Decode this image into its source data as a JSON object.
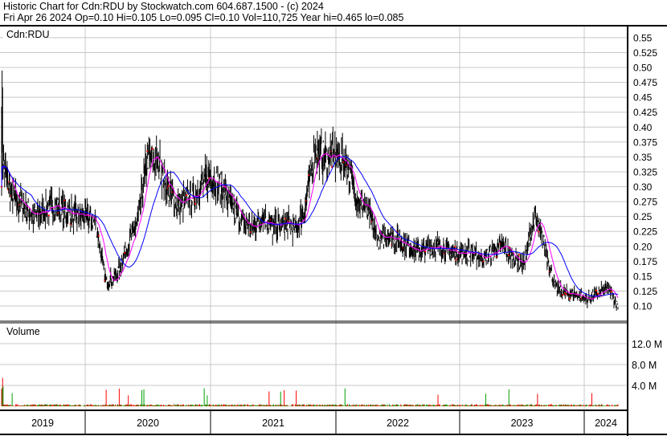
{
  "header": {
    "line1": "Historic Chart for Cdn:RDU by Stockwatch.com 604.687.1500 - (c) 2024",
    "line2": "Fri Apr 26 2024  Op=0.10  Hi=0.105  Lo=0.095  Cl=0.10  Vol=110,725  Year hi=0.465  lo=0.085"
  },
  "chart_data": {
    "type": "line",
    "title": "Cdn:RDU",
    "volume_label": "Volume",
    "start_month": "2019-05",
    "monthly_close": [
      0.35,
      0.28,
      0.27,
      0.25,
      0.26,
      0.27,
      0.26,
      0.25,
      0.25,
      0.24,
      0.14,
      0.15,
      0.2,
      0.24,
      0.35,
      0.34,
      0.29,
      0.27,
      0.28,
      0.3,
      0.32,
      0.3,
      0.27,
      0.24,
      0.23,
      0.25,
      0.23,
      0.24,
      0.23,
      0.26,
      0.36,
      0.35,
      0.35,
      0.34,
      0.28,
      0.26,
      0.21,
      0.22,
      0.21,
      0.2,
      0.19,
      0.2,
      0.2,
      0.19,
      0.19,
      0.19,
      0.18,
      0.19,
      0.2,
      0.18,
      0.17,
      0.25,
      0.2,
      0.13,
      0.12,
      0.12,
      0.11,
      0.12,
      0.13,
      0.1
    ],
    "price_ticks": [
      "0.55",
      "0.525",
      "0.50",
      "0.475",
      "0.45",
      "0.425",
      "0.40",
      "0.375",
      "0.35",
      "0.325",
      "0.30",
      "0.275",
      "0.25",
      "0.225",
      "0.20",
      "0.175",
      "0.15",
      "0.125",
      "0.10"
    ],
    "ylim": [
      0.075,
      0.575
    ],
    "volume_ticks": [
      "12.0 M",
      "8.0 M",
      "4.0 M"
    ],
    "volume_ylim": [
      0,
      16000000
    ],
    "years": [
      "2019",
      "2020",
      "2021",
      "2022",
      "2023",
      "2024"
    ],
    "colors": {
      "price": "#000000",
      "ma_short": "#ff00ff",
      "ma_long": "#0000ff",
      "vol_up": "#00a000",
      "vol_down": "#ff0000",
      "grid": "#c8c8c8"
    }
  }
}
